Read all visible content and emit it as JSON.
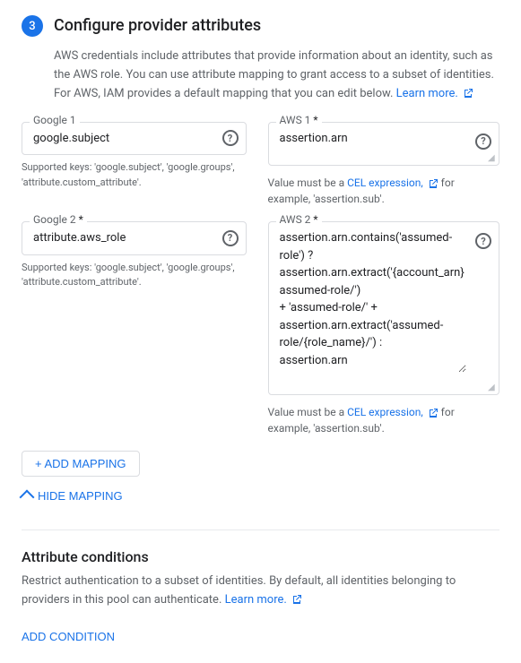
{
  "step": {
    "number": "3",
    "title": "Configure provider attributes",
    "description": "AWS credentials include attributes that provide information about an identity, such as the AWS role. You can use attribute mapping to grant access to a subset of identities. For AWS, IAM provides a default mapping that you can edit below.",
    "learn_more_label": "Learn more.",
    "learn_more_url": "#"
  },
  "mapping": {
    "google1": {
      "label": "Google 1",
      "value": "google.subject",
      "supported_keys": "Supported keys: 'google.subject', 'google.groups', 'attribute.custom_attribute'."
    },
    "google2": {
      "label": "Google 2",
      "required": true,
      "value": "attribute.aws_role",
      "supported_keys": "Supported keys: 'google.subject', 'google.groups', 'attribute.custom_attribute'."
    },
    "aws1": {
      "label": "AWS 1",
      "required": true,
      "value": "assertion.arn",
      "cel_note": "Value must be a",
      "cel_link": "CEL expression,",
      "cel_example": " for example, 'assertion.sub'."
    },
    "aws2": {
      "label": "AWS 2",
      "required": true,
      "value": "assertion.arn.contains('assumed-role') ?\nassertion.arn.extract('{account_arn}assumed-role/')\n+ 'assumed-role/' +\nassertion.arn.extract('assumed-role/{role_name}/') :\nassertion.arn",
      "cel_note": "Value must be a",
      "cel_link": "CEL expression,",
      "cel_example": " for example, 'assertion.sub'."
    }
  },
  "buttons": {
    "add_mapping": "+ ADD MAPPING",
    "hide_mapping": "HIDE MAPPING",
    "add_condition": "ADD CONDITION"
  },
  "attribute_conditions": {
    "title": "Attribute conditions",
    "description": "Restrict authentication to a subset of identities. By default, all identities belonging to providers in this pool can authenticate.",
    "learn_more_label": "Learn more.",
    "learn_more_url": "#"
  },
  "icons": {
    "help": "?",
    "plus": "+",
    "chevron_up": "^",
    "external_link": "↗"
  }
}
